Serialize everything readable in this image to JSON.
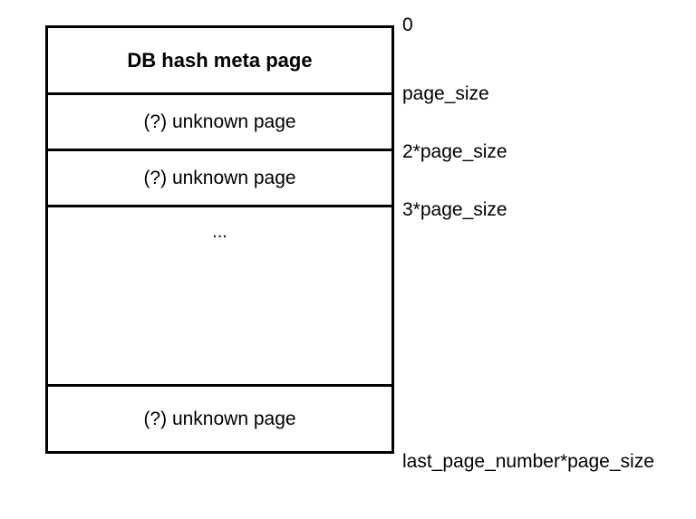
{
  "rows": {
    "meta": "DB hash meta page",
    "p1": "(?) unknown page",
    "p2": "(?) unknown page",
    "gap": "...",
    "last": "(?) unknown page"
  },
  "offsets": {
    "o0": "0",
    "o1": "page_size",
    "o2": "2*page_size",
    "o3": "3*page_size",
    "o4": "last_page_number*page_size"
  }
}
